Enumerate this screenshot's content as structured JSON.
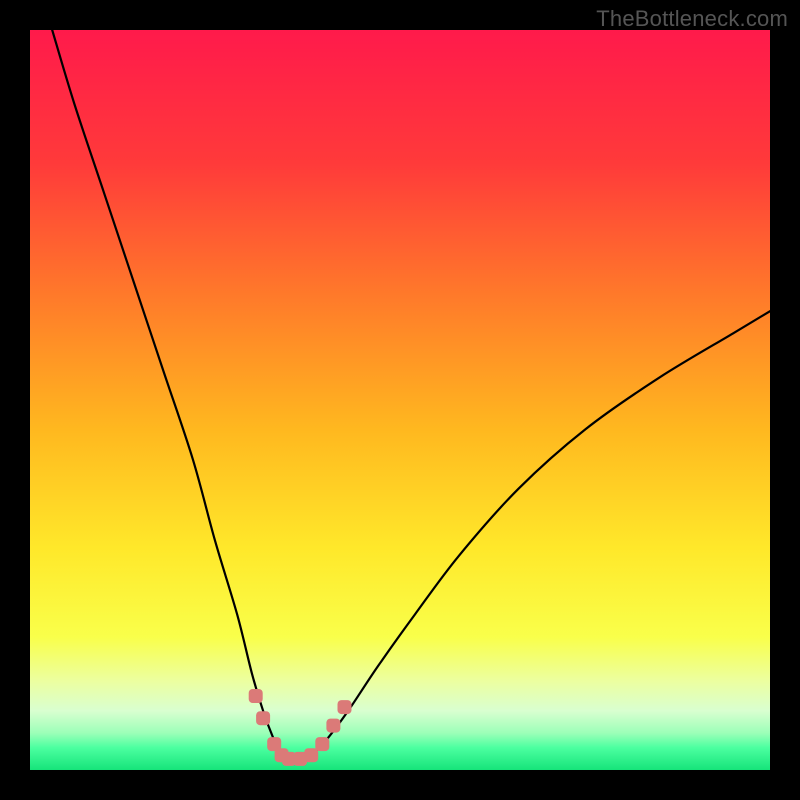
{
  "watermark": {
    "text": "TheBottleneck.com"
  },
  "colors": {
    "black": "#000000",
    "curve": "#000000",
    "marker": "#db7a78",
    "gradient_stops": [
      {
        "pct": 0,
        "c": "#ff1a4b"
      },
      {
        "pct": 18,
        "c": "#ff3a3a"
      },
      {
        "pct": 36,
        "c": "#ff7a2a"
      },
      {
        "pct": 54,
        "c": "#ffb81f"
      },
      {
        "pct": 70,
        "c": "#ffe82a"
      },
      {
        "pct": 82,
        "c": "#f9ff4a"
      },
      {
        "pct": 88,
        "c": "#ecffa0"
      },
      {
        "pct": 92,
        "c": "#d9ffd0"
      },
      {
        "pct": 95,
        "c": "#9cffb8"
      },
      {
        "pct": 97,
        "c": "#4bffa0"
      },
      {
        "pct": 100,
        "c": "#16e47a"
      }
    ]
  },
  "chart_data": {
    "type": "line",
    "title": "",
    "xlabel": "",
    "ylabel": "",
    "xlim": [
      0,
      100
    ],
    "ylim": [
      0,
      100
    ],
    "series": [
      {
        "name": "bottleneck-curve",
        "x": [
          3,
          6,
          10,
          14,
          18,
          22,
          25,
          28,
          30,
          31.5,
          33,
          34,
          35,
          36.5,
          38,
          40,
          43,
          47,
          52,
          58,
          66,
          75,
          85,
          95,
          100
        ],
        "y": [
          100,
          90,
          78,
          66,
          54,
          42,
          31,
          21,
          13,
          8,
          4,
          2,
          1.2,
          1.2,
          2,
          4,
          8,
          14,
          21,
          29,
          38,
          46,
          53,
          59,
          62
        ]
      }
    ],
    "markers": {
      "name": "highlight-points",
      "x": [
        30.5,
        31.5,
        33,
        34,
        35,
        36.5,
        38,
        39.5,
        41,
        42.5
      ],
      "y": [
        10,
        7,
        3.5,
        2,
        1.5,
        1.5,
        2,
        3.5,
        6,
        8.5
      ]
    }
  }
}
